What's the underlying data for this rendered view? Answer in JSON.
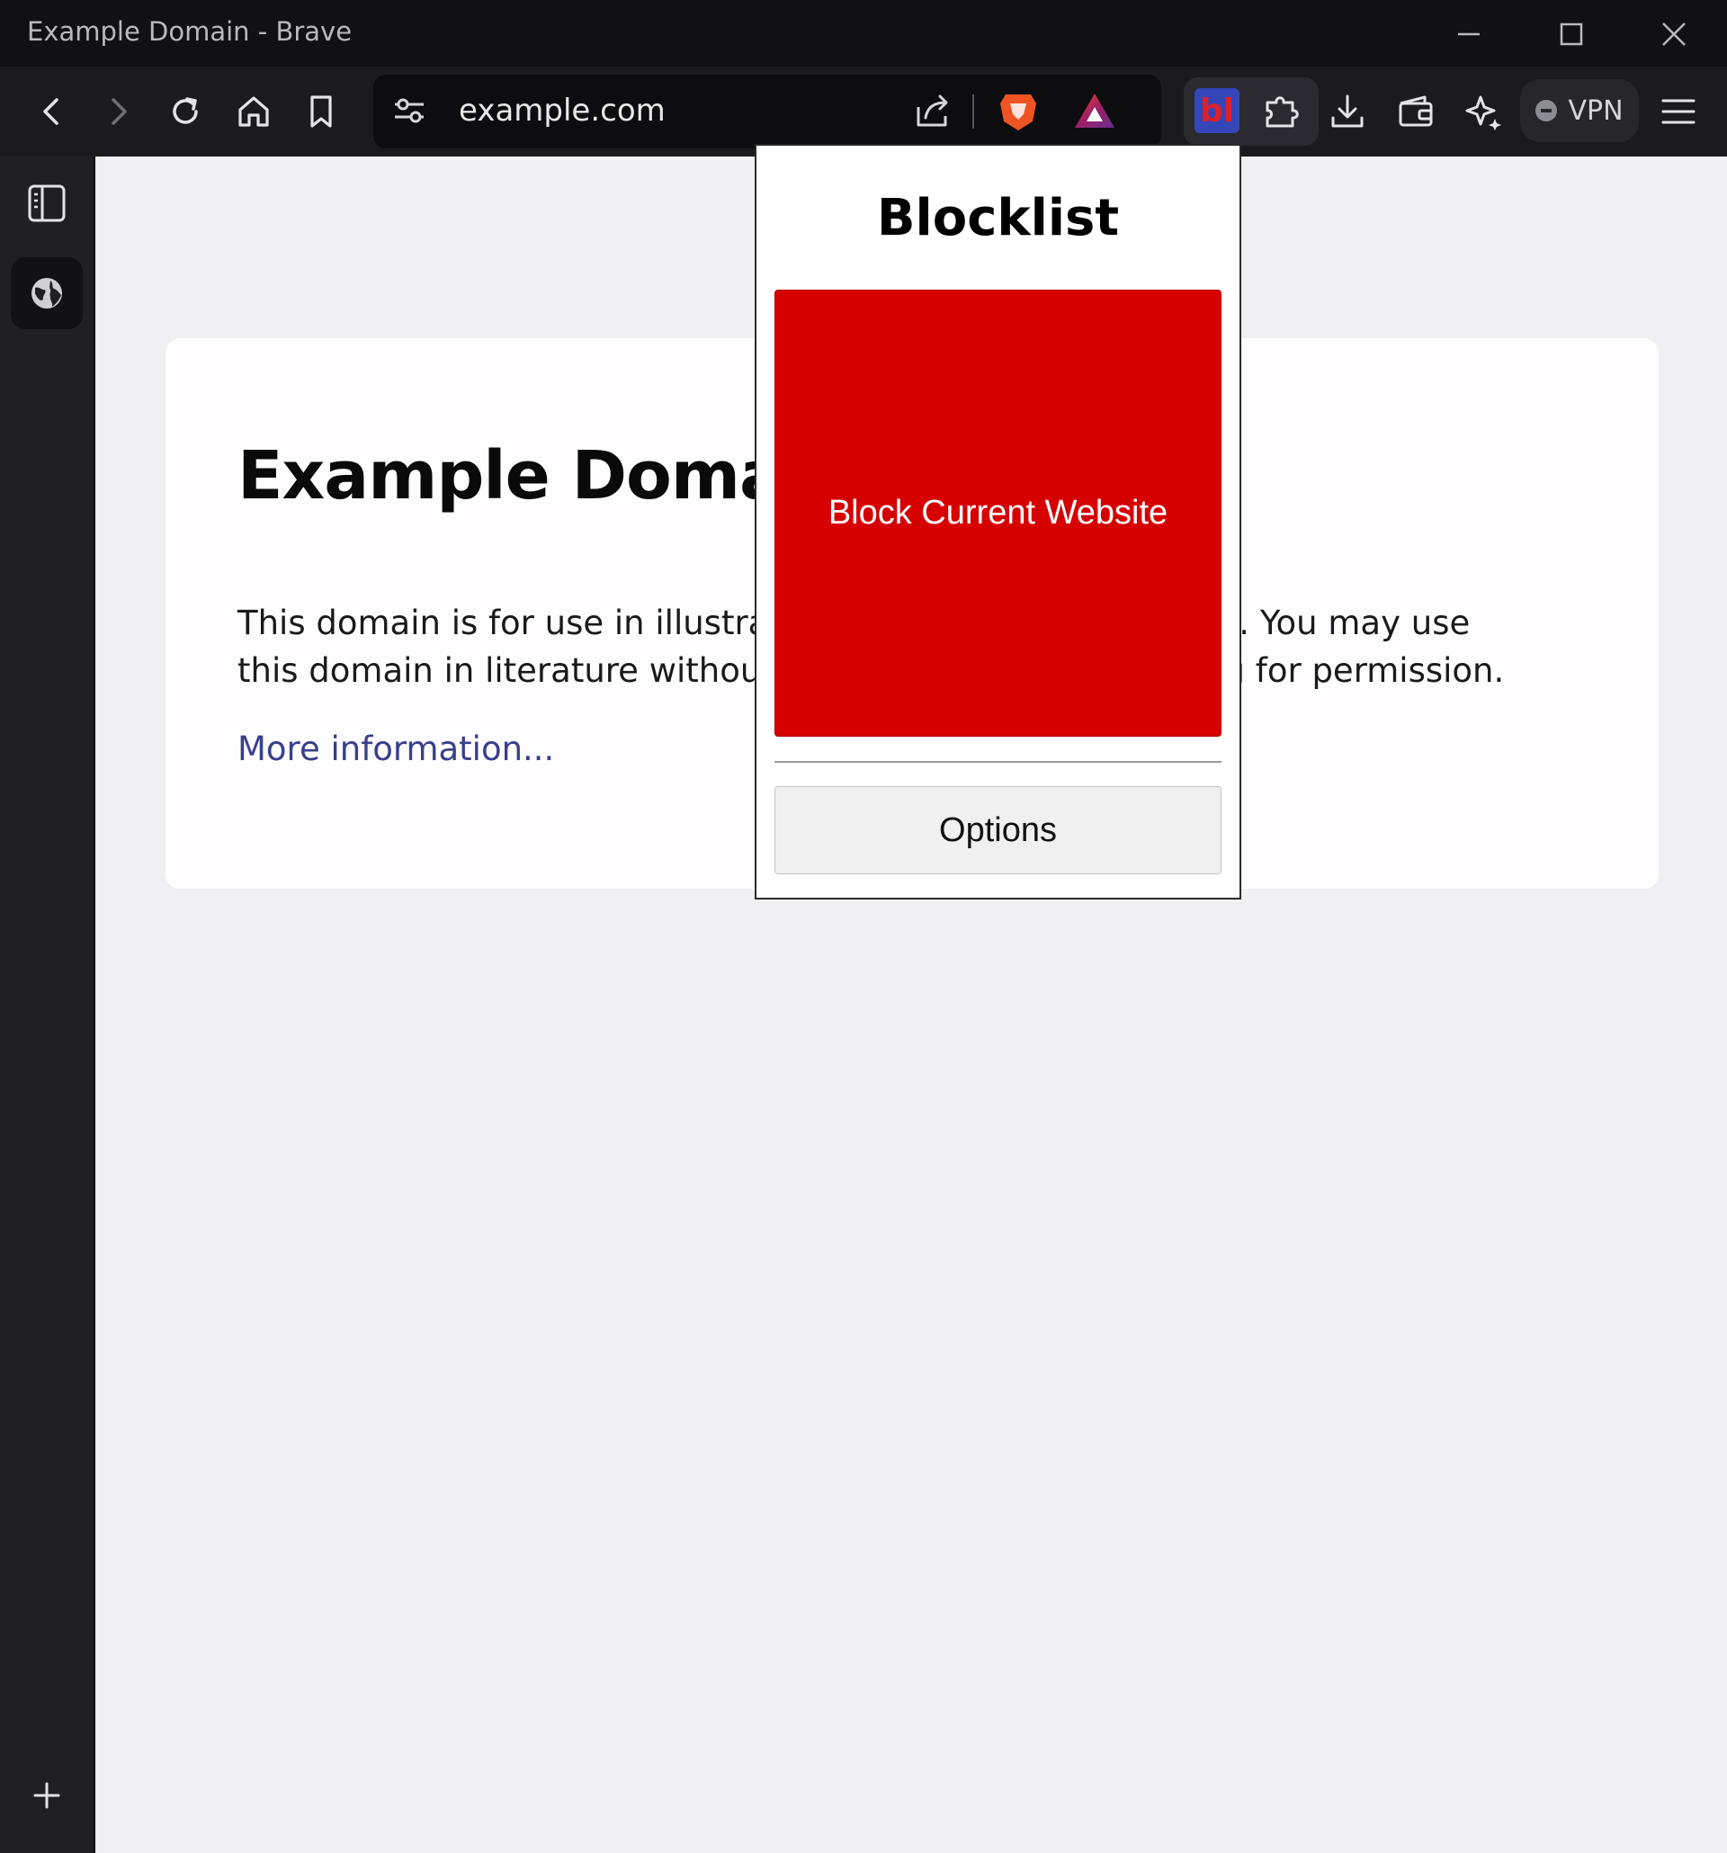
{
  "window": {
    "title": "Example Domain - Brave"
  },
  "toolbar": {
    "url": "example.com",
    "vpn_label": "VPN",
    "extension_badge": "bl"
  },
  "icons": {
    "back": "arrow-left-icon",
    "forward": "arrow-right-icon",
    "reload": "reload-icon",
    "home": "home-icon",
    "bookmark": "bookmark-icon",
    "site_settings": "sliders-icon",
    "share": "share-icon",
    "brave_shields": "brave-lion-icon",
    "brave_rewards": "triangle-icon",
    "extensions": "puzzle-icon",
    "downloads": "download-icon",
    "wallet": "wallet-icon",
    "leo": "sparkle-icon",
    "menu": "hamburger-icon",
    "sidebar_toggle": "sidebar-panel-icon",
    "sidebar_globe": "globe-icon",
    "sidebar_add": "plus-icon"
  },
  "page": {
    "heading": "Example Domain",
    "paragraph": "This domain is for use in illustrative examples in documents. You may use this domain in literature without prior coordination or asking for permission.",
    "link": "More information..."
  },
  "popup": {
    "title": "Blocklist",
    "block_button": "Block Current Website",
    "options_button": "Options",
    "block_color": "#d60000"
  }
}
